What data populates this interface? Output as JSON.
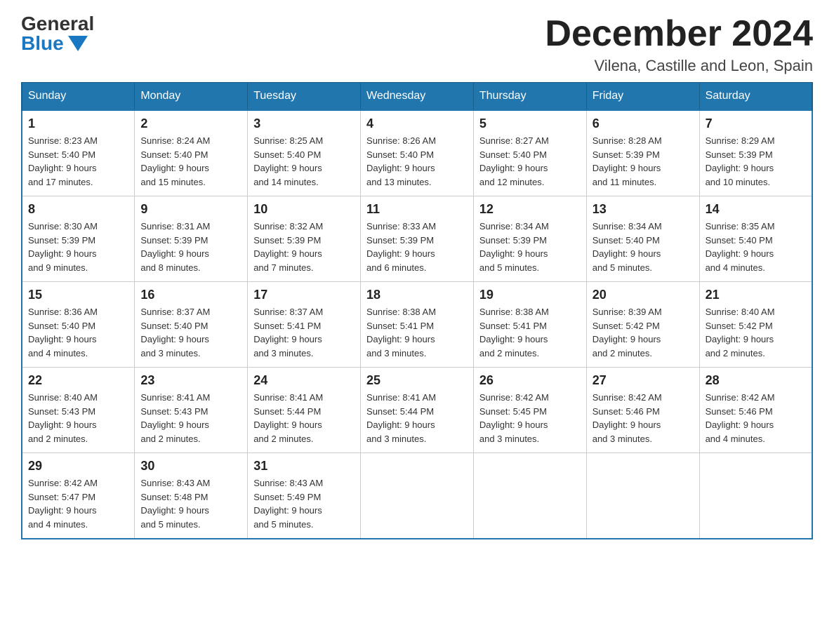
{
  "logo": {
    "general": "General",
    "blue": "Blue"
  },
  "title": "December 2024",
  "subtitle": "Vilena, Castille and Leon, Spain",
  "days_header": [
    "Sunday",
    "Monday",
    "Tuesday",
    "Wednesday",
    "Thursday",
    "Friday",
    "Saturday"
  ],
  "weeks": [
    [
      {
        "num": "1",
        "sunrise": "8:23 AM",
        "sunset": "5:40 PM",
        "daylight": "9 hours and 17 minutes."
      },
      {
        "num": "2",
        "sunrise": "8:24 AM",
        "sunset": "5:40 PM",
        "daylight": "9 hours and 15 minutes."
      },
      {
        "num": "3",
        "sunrise": "8:25 AM",
        "sunset": "5:40 PM",
        "daylight": "9 hours and 14 minutes."
      },
      {
        "num": "4",
        "sunrise": "8:26 AM",
        "sunset": "5:40 PM",
        "daylight": "9 hours and 13 minutes."
      },
      {
        "num": "5",
        "sunrise": "8:27 AM",
        "sunset": "5:40 PM",
        "daylight": "9 hours and 12 minutes."
      },
      {
        "num": "6",
        "sunrise": "8:28 AM",
        "sunset": "5:39 PM",
        "daylight": "9 hours and 11 minutes."
      },
      {
        "num": "7",
        "sunrise": "8:29 AM",
        "sunset": "5:39 PM",
        "daylight": "9 hours and 10 minutes."
      }
    ],
    [
      {
        "num": "8",
        "sunrise": "8:30 AM",
        "sunset": "5:39 PM",
        "daylight": "9 hours and 9 minutes."
      },
      {
        "num": "9",
        "sunrise": "8:31 AM",
        "sunset": "5:39 PM",
        "daylight": "9 hours and 8 minutes."
      },
      {
        "num": "10",
        "sunrise": "8:32 AM",
        "sunset": "5:39 PM",
        "daylight": "9 hours and 7 minutes."
      },
      {
        "num": "11",
        "sunrise": "8:33 AM",
        "sunset": "5:39 PM",
        "daylight": "9 hours and 6 minutes."
      },
      {
        "num": "12",
        "sunrise": "8:34 AM",
        "sunset": "5:39 PM",
        "daylight": "9 hours and 5 minutes."
      },
      {
        "num": "13",
        "sunrise": "8:34 AM",
        "sunset": "5:40 PM",
        "daylight": "9 hours and 5 minutes."
      },
      {
        "num": "14",
        "sunrise": "8:35 AM",
        "sunset": "5:40 PM",
        "daylight": "9 hours and 4 minutes."
      }
    ],
    [
      {
        "num": "15",
        "sunrise": "8:36 AM",
        "sunset": "5:40 PM",
        "daylight": "9 hours and 4 minutes."
      },
      {
        "num": "16",
        "sunrise": "8:37 AM",
        "sunset": "5:40 PM",
        "daylight": "9 hours and 3 minutes."
      },
      {
        "num": "17",
        "sunrise": "8:37 AM",
        "sunset": "5:41 PM",
        "daylight": "9 hours and 3 minutes."
      },
      {
        "num": "18",
        "sunrise": "8:38 AM",
        "sunset": "5:41 PM",
        "daylight": "9 hours and 3 minutes."
      },
      {
        "num": "19",
        "sunrise": "8:38 AM",
        "sunset": "5:41 PM",
        "daylight": "9 hours and 2 minutes."
      },
      {
        "num": "20",
        "sunrise": "8:39 AM",
        "sunset": "5:42 PM",
        "daylight": "9 hours and 2 minutes."
      },
      {
        "num": "21",
        "sunrise": "8:40 AM",
        "sunset": "5:42 PM",
        "daylight": "9 hours and 2 minutes."
      }
    ],
    [
      {
        "num": "22",
        "sunrise": "8:40 AM",
        "sunset": "5:43 PM",
        "daylight": "9 hours and 2 minutes."
      },
      {
        "num": "23",
        "sunrise": "8:41 AM",
        "sunset": "5:43 PM",
        "daylight": "9 hours and 2 minutes."
      },
      {
        "num": "24",
        "sunrise": "8:41 AM",
        "sunset": "5:44 PM",
        "daylight": "9 hours and 2 minutes."
      },
      {
        "num": "25",
        "sunrise": "8:41 AM",
        "sunset": "5:44 PM",
        "daylight": "9 hours and 3 minutes."
      },
      {
        "num": "26",
        "sunrise": "8:42 AM",
        "sunset": "5:45 PM",
        "daylight": "9 hours and 3 minutes."
      },
      {
        "num": "27",
        "sunrise": "8:42 AM",
        "sunset": "5:46 PM",
        "daylight": "9 hours and 3 minutes."
      },
      {
        "num": "28",
        "sunrise": "8:42 AM",
        "sunset": "5:46 PM",
        "daylight": "9 hours and 4 minutes."
      }
    ],
    [
      {
        "num": "29",
        "sunrise": "8:42 AM",
        "sunset": "5:47 PM",
        "daylight": "9 hours and 4 minutes."
      },
      {
        "num": "30",
        "sunrise": "8:43 AM",
        "sunset": "5:48 PM",
        "daylight": "9 hours and 5 minutes."
      },
      {
        "num": "31",
        "sunrise": "8:43 AM",
        "sunset": "5:49 PM",
        "daylight": "9 hours and 5 minutes."
      },
      null,
      null,
      null,
      null
    ]
  ],
  "labels": {
    "sunrise": "Sunrise:",
    "sunset": "Sunset:",
    "daylight": "Daylight:"
  }
}
